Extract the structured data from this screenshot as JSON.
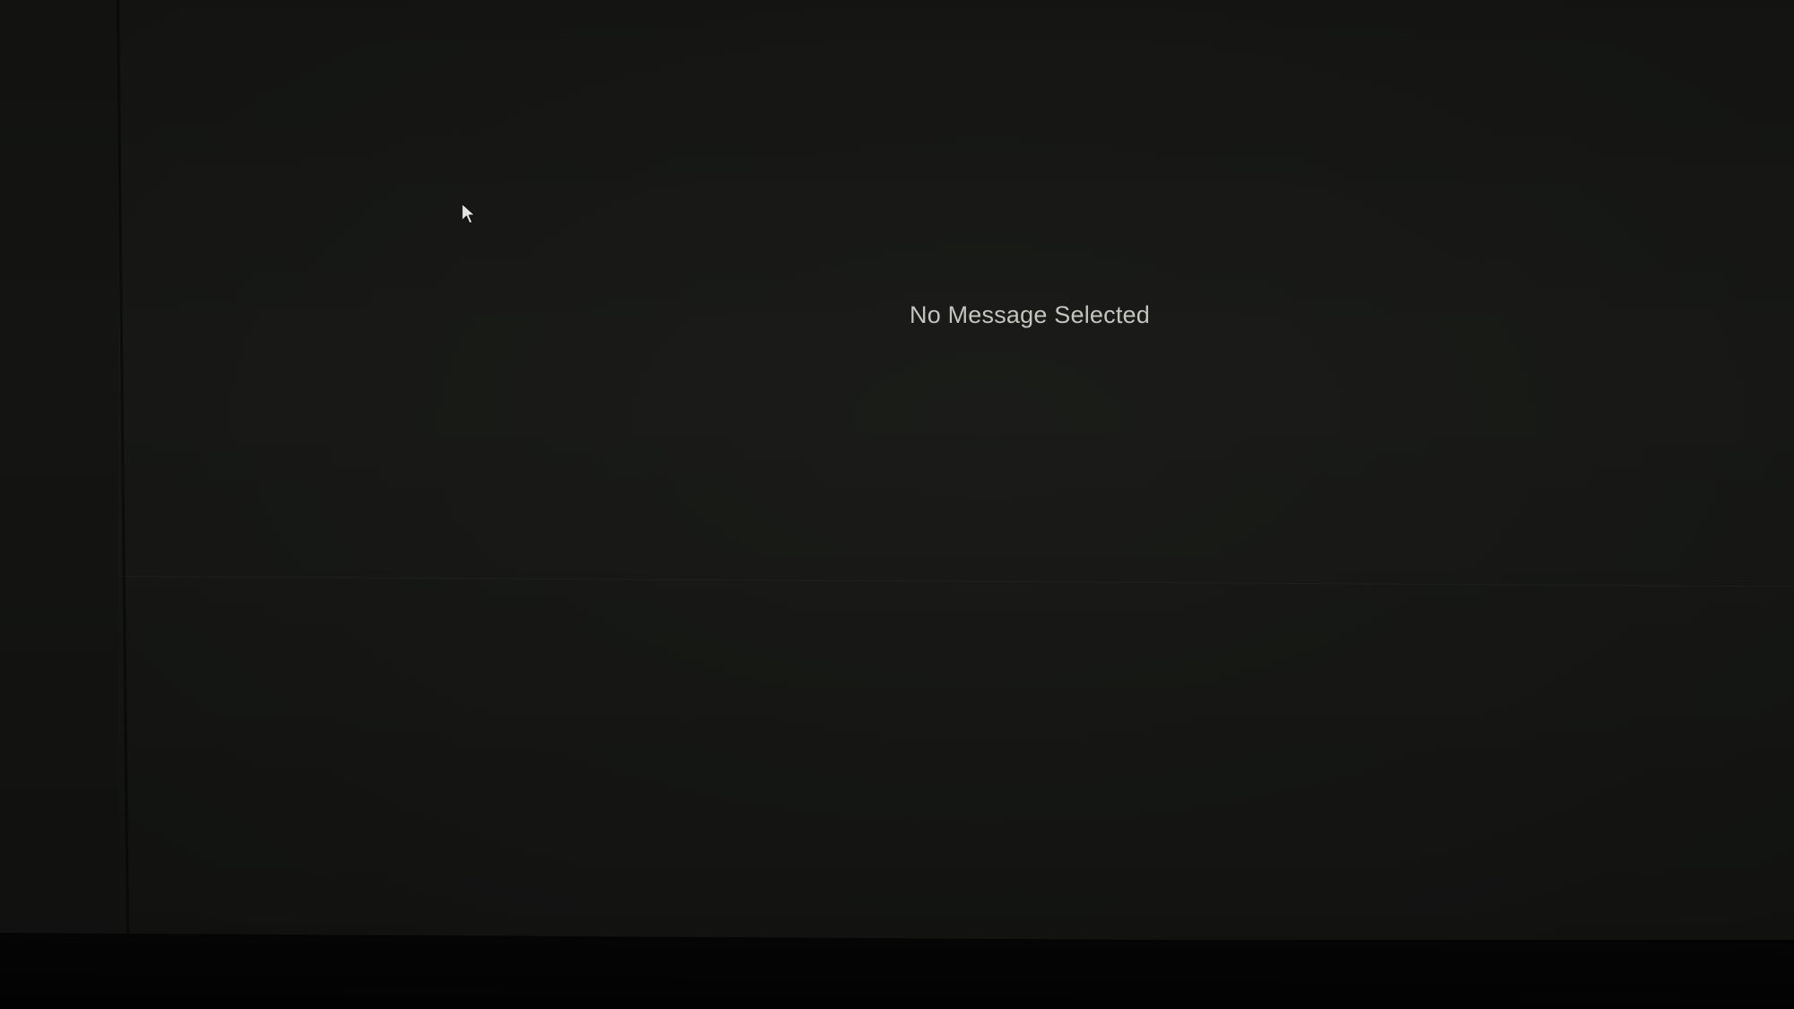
{
  "window": {
    "empty_state_text": "No Message Selected"
  },
  "cursor": {
    "icon": "mouse-pointer-icon"
  },
  "colors": {
    "background": "#181916",
    "text": "#c8c8c2"
  }
}
